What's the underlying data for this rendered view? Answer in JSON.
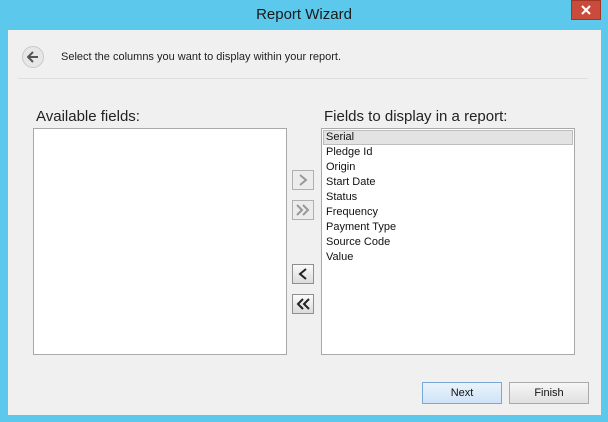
{
  "window": {
    "title": "Report Wizard"
  },
  "header": {
    "instruction": "Select the columns you want to display within your report."
  },
  "available": {
    "label": "Available fields:",
    "items": []
  },
  "display": {
    "label": "Fields to display in a report:",
    "items": [
      "Serial",
      "Pledge Id",
      "Origin",
      "Start Date",
      "Status",
      "Frequency",
      "Payment Type",
      "Source Code",
      "Value"
    ],
    "selected_index": 0
  },
  "buttons": {
    "next": "Next",
    "finish": "Finish"
  },
  "icons": {
    "back": "back-arrow-icon",
    "close": "close-icon",
    "add": "chevron-right-icon",
    "add_all": "double-chevron-right-icon",
    "remove": "chevron-left-icon",
    "remove_all": "double-chevron-left-icon"
  },
  "colors": {
    "title_bar": "#5bc8ec",
    "close": "#c94b3c",
    "next_border": "#7aa7d6"
  }
}
